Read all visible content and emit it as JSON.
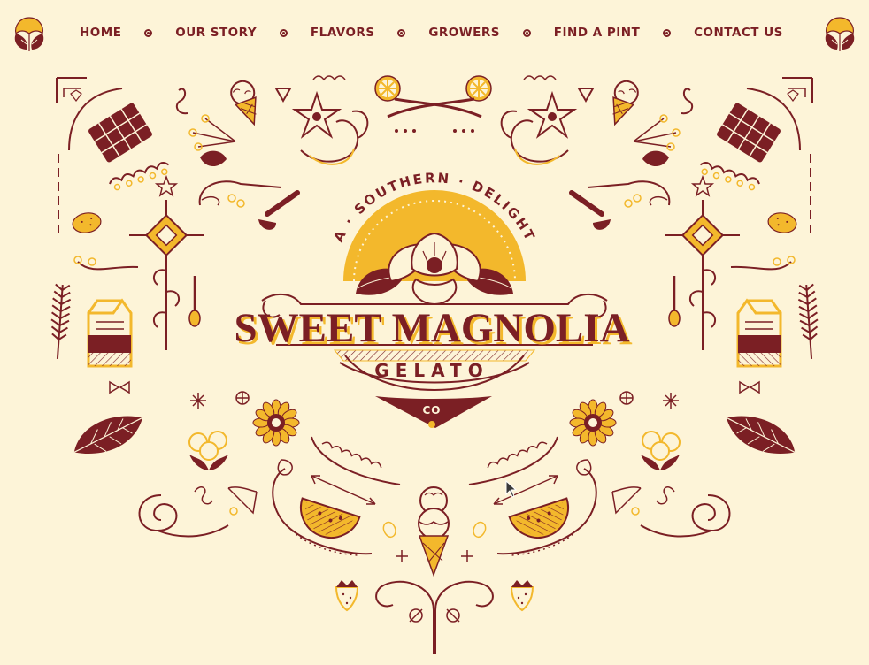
{
  "nav": {
    "items": [
      {
        "label": "HOME",
        "name": "nav-home"
      },
      {
        "label": "OUR STORY",
        "name": "nav-our-story"
      },
      {
        "label": "FLAVORS",
        "name": "nav-flavors"
      },
      {
        "label": "GROWERS",
        "name": "nav-growers"
      },
      {
        "label": "FIND A PINT",
        "name": "nav-find-a-pint"
      },
      {
        "label": "CONTACT US",
        "name": "nav-contact-us"
      }
    ]
  },
  "brand": {
    "arc_text": "A · SOUTHERN · DELIGHT",
    "name": "SWEET MAGNOLIA",
    "product": "GELATO",
    "suffix": "CO"
  },
  "colors": {
    "background": "#fdf4d8",
    "maroon": "#7b1f24",
    "gold": "#f3b82c",
    "cream": "#fdf4d8"
  },
  "icons": [
    "magnolia-icon",
    "ice-cream-cone-icon",
    "chocolate-bar-icon",
    "star-anise-icon",
    "lemon-icon",
    "milk-carton-icon",
    "leaf-icon",
    "watermelon-icon",
    "strawberry-icon",
    "sunflower-icon",
    "cotton-icon",
    "lemon-slice-icon",
    "wheat-icon",
    "cursor-icon"
  ]
}
